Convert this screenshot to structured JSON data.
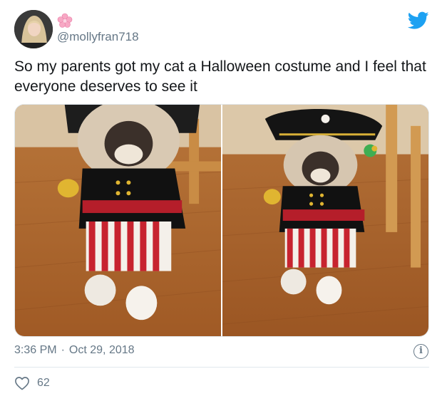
{
  "tweet": {
    "handle": "@mollyfran718",
    "text": "So my parents got my cat a Halloween costume and I feel that everyone deserves to see it",
    "time": "3:36 PM",
    "separator": "·",
    "date": "Oct 29, 2018",
    "like_count": "62",
    "info_glyph": "i"
  },
  "icons": {
    "brand": "twitter-bird-icon",
    "badge": "cherry-blossom-icon",
    "like": "heart-icon",
    "info": "info-icon"
  },
  "colors": {
    "twitter_blue": "#1da1f2",
    "secondary_text": "#657786",
    "primary_text": "#14171a"
  },
  "media": [
    "photo of cat in pirate costume, front view",
    "photo of cat in pirate costume with hat"
  ]
}
